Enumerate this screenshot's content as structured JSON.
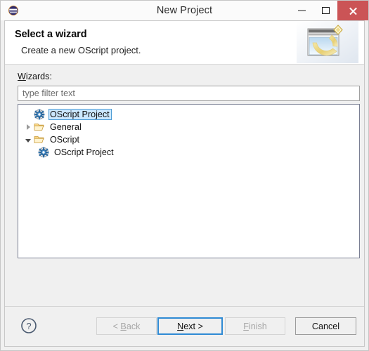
{
  "window": {
    "title": "New Project",
    "app_icon": "eclipse-icon",
    "controls": {
      "minimize": "minimize-icon",
      "maximize": "maximize-icon",
      "close": "close-icon"
    }
  },
  "banner": {
    "title": "Select a wizard",
    "description": "Create a new OScript project.",
    "art": "new-project-wizard-banner-icon"
  },
  "content": {
    "wizards_label_mnemonic": "W",
    "wizards_label_rest": "izards:",
    "filter": {
      "value": "",
      "placeholder": "type filter text"
    },
    "tree": [
      {
        "label": "OScript Project",
        "icon": "oscript-project-icon",
        "indent": 1,
        "twisty": "none",
        "selected": true
      },
      {
        "label": "General",
        "icon": "folder-open-icon",
        "indent": 0,
        "twisty": "collapsed",
        "selected": false
      },
      {
        "label": "OScript",
        "icon": "folder-open-icon",
        "indent": 0,
        "twisty": "expanded",
        "selected": false
      },
      {
        "label": "OScript Project",
        "icon": "oscript-project-icon",
        "indent": 2,
        "twisty": "none",
        "selected": false
      }
    ]
  },
  "buttons": {
    "help": "help-icon",
    "back": {
      "prefix": "< ",
      "mnemonic": "B",
      "suffix": "ack",
      "enabled": false
    },
    "next": {
      "prefix": "",
      "mnemonic": "N",
      "suffix": "ext >",
      "enabled": true,
      "focused": true
    },
    "finish": {
      "prefix": "",
      "mnemonic": "F",
      "suffix": "inish",
      "enabled": false
    },
    "cancel": {
      "label": "Cancel",
      "enabled": true
    }
  },
  "colors": {
    "close_button": "#cb5456",
    "focus_border": "#2f8ad4",
    "selection_bg": "#cce8ff",
    "dialog_bg": "#f0f0f0",
    "tree_border": "#7a7f93"
  }
}
